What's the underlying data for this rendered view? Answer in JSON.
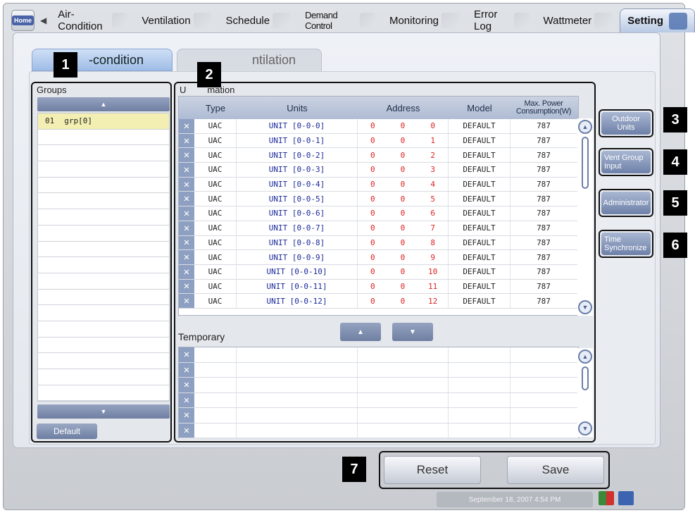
{
  "top_tabs": {
    "home": "Home",
    "items": [
      {
        "label": "Air-Condition"
      },
      {
        "label": "Ventilation"
      },
      {
        "label": "Schedule"
      },
      {
        "label": "Demand Control"
      },
      {
        "label": "Monitoring"
      },
      {
        "label": "Error Log"
      },
      {
        "label": "Wattmeter"
      },
      {
        "label": "Setting"
      }
    ]
  },
  "sub_tabs": {
    "air_condition": "-condition",
    "ventilation": "ntilation"
  },
  "groups": {
    "title": "Groups",
    "items": [
      {
        "num": "01",
        "name": "grp[0]"
      }
    ],
    "default_label": "Default"
  },
  "unit_info": {
    "title": "U",
    "title_suffix": "mation",
    "columns": {
      "type": "Type",
      "units": "Units",
      "address": "Address",
      "model": "Model",
      "max_power_line1": "Max. Power",
      "max_power_line2": "Consumption(W)"
    },
    "rows": [
      {
        "type": "UAC",
        "unit": "UNIT [0-0-0]",
        "a1": "0",
        "a2": "0",
        "a3": "0",
        "model": "DEFAULT",
        "power": "787"
      },
      {
        "type": "UAC",
        "unit": "UNIT [0-0-1]",
        "a1": "0",
        "a2": "0",
        "a3": "1",
        "model": "DEFAULT",
        "power": "787"
      },
      {
        "type": "UAC",
        "unit": "UNIT [0-0-2]",
        "a1": "0",
        "a2": "0",
        "a3": "2",
        "model": "DEFAULT",
        "power": "787"
      },
      {
        "type": "UAC",
        "unit": "UNIT [0-0-3]",
        "a1": "0",
        "a2": "0",
        "a3": "3",
        "model": "DEFAULT",
        "power": "787"
      },
      {
        "type": "UAC",
        "unit": "UNIT [0-0-4]",
        "a1": "0",
        "a2": "0",
        "a3": "4",
        "model": "DEFAULT",
        "power": "787"
      },
      {
        "type": "UAC",
        "unit": "UNIT [0-0-5]",
        "a1": "0",
        "a2": "0",
        "a3": "5",
        "model": "DEFAULT",
        "power": "787"
      },
      {
        "type": "UAC",
        "unit": "UNIT [0-0-6]",
        "a1": "0",
        "a2": "0",
        "a3": "6",
        "model": "DEFAULT",
        "power": "787"
      },
      {
        "type": "UAC",
        "unit": "UNIT [0-0-7]",
        "a1": "0",
        "a2": "0",
        "a3": "7",
        "model": "DEFAULT",
        "power": "787"
      },
      {
        "type": "UAC",
        "unit": "UNIT [0-0-8]",
        "a1": "0",
        "a2": "0",
        "a3": "8",
        "model": "DEFAULT",
        "power": "787"
      },
      {
        "type": "UAC",
        "unit": "UNIT [0-0-9]",
        "a1": "0",
        "a2": "0",
        "a3": "9",
        "model": "DEFAULT",
        "power": "787"
      },
      {
        "type": "UAC",
        "unit": "UNIT [0-0-10]",
        "a1": "0",
        "a2": "0",
        "a3": "10",
        "model": "DEFAULT",
        "power": "787"
      },
      {
        "type": "UAC",
        "unit": "UNIT [0-0-11]",
        "a1": "0",
        "a2": "0",
        "a3": "11",
        "model": "DEFAULT",
        "power": "787"
      },
      {
        "type": "UAC",
        "unit": "UNIT [0-0-12]",
        "a1": "0",
        "a2": "0",
        "a3": "12",
        "model": "DEFAULT",
        "power": "787"
      }
    ]
  },
  "temporary": {
    "title": "Temporary",
    "row_count": 6
  },
  "side_buttons": {
    "outdoor_units": "Outdoor Units",
    "vent_group_input": "Vent Group Input",
    "administrator": "Administrator",
    "time_synchronize": "Time Synchronize"
  },
  "bottom": {
    "reset": "Reset",
    "save": "Save"
  },
  "status": {
    "datetime": "September 18, 2007 4:54 PM"
  },
  "callouts": [
    "1",
    "2",
    "3",
    "4",
    "5",
    "6",
    "7"
  ],
  "colors": {
    "accent": "#4c6fae",
    "unit_text": "#1b2a9a",
    "address_text": "#dd2222",
    "selected_row": "#f3efb2"
  }
}
